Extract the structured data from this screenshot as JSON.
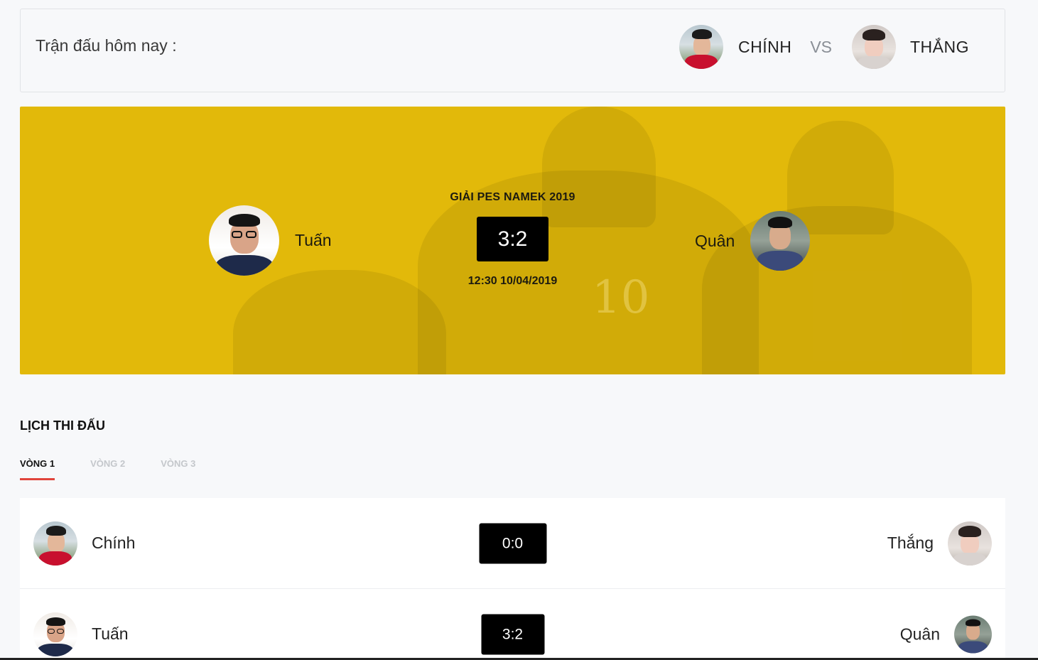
{
  "today": {
    "label": "Trận đấu hôm nay :",
    "player1": "CHÍNH",
    "vs": "VS",
    "player2": "THẮNG"
  },
  "featured": {
    "title": "GIẢI PES NAMEK 2019",
    "home": "Tuấn",
    "away": "Quân",
    "score": "3:2",
    "datetime": "12:30 10/04/2019",
    "shirt_number": "10",
    "accent_color": "#e2b90a"
  },
  "schedule": {
    "title": "LỊCH THI ĐẤU",
    "tabs": [
      "VÒNG 1",
      "VÒNG 2",
      "VÒNG 3"
    ],
    "active_tab": "VÒNG 1",
    "accent_color": "#e0443b",
    "matches": [
      {
        "home": "Chính",
        "score": "0:0",
        "away": "Thắng"
      },
      {
        "home": "Tuấn",
        "score": "3:2",
        "away": "Quân"
      }
    ]
  }
}
